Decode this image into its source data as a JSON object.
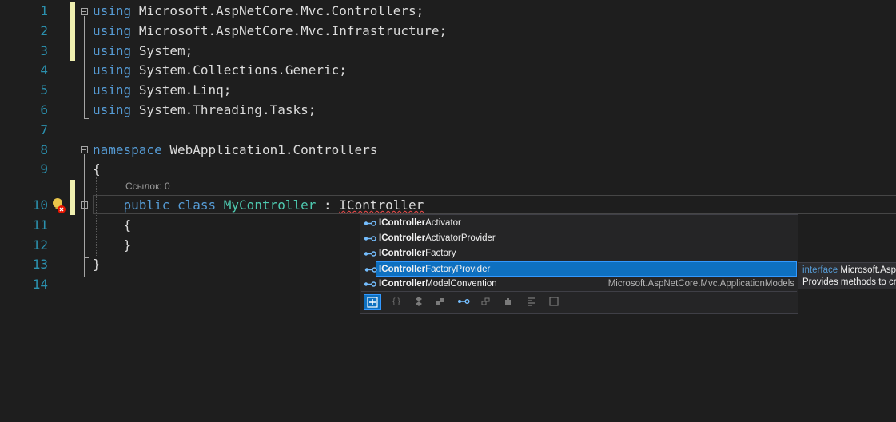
{
  "editor": {
    "lines": [
      {
        "n": "1",
        "tokens": [
          "using",
          "Microsoft.AspNetCore.Mvc.Controllers;"
        ]
      },
      {
        "n": "2",
        "tokens": [
          "using",
          "Microsoft.AspNetCore.Mvc.Infrastructure;"
        ]
      },
      {
        "n": "3",
        "tokens": [
          "using",
          "System;"
        ]
      },
      {
        "n": "4",
        "tokens": [
          "using",
          "System.Collections.Generic;"
        ]
      },
      {
        "n": "5",
        "tokens": [
          "using",
          "System.Linq;"
        ]
      },
      {
        "n": "6",
        "tokens": [
          "using",
          "System.Threading.Tasks;"
        ]
      },
      {
        "n": "7",
        "tokens": []
      },
      {
        "n": "8",
        "tokens": [
          "namespace",
          "WebApplication1.Controllers"
        ]
      },
      {
        "n": "9",
        "tokens": [
          "{"
        ]
      },
      {
        "n": "10",
        "tokens": [
          "public",
          "class",
          "MyController",
          ":",
          "IController"
        ]
      },
      {
        "n": "11",
        "tokens": [
          "{"
        ]
      },
      {
        "n": "12",
        "tokens": [
          "}"
        ]
      },
      {
        "n": "13",
        "tokens": [
          "}"
        ]
      },
      {
        "n": "14",
        "tokens": []
      }
    ],
    "codelens": "Ссылок: 0"
  },
  "completion": {
    "items": [
      {
        "bold": "IController",
        "rest": "Activator",
        "detail": ""
      },
      {
        "bold": "IController",
        "rest": "ActivatorProvider",
        "detail": ""
      },
      {
        "bold": "IController",
        "rest": "Factory",
        "detail": ""
      },
      {
        "bold": "IController",
        "rest": "FactoryProvider",
        "detail": "",
        "selected": true
      },
      {
        "bold": "IController",
        "rest": "ModelConvention",
        "detail": "Microsoft.AspNetCore.Mvc.ApplicationModels"
      }
    ],
    "filter_icons": [
      "expand-filter-icon",
      "namespace-filter-icon",
      "class-filter-icon",
      "structure-filter-icon",
      "interface-filter-icon",
      "enum-filter-icon",
      "delegate-filter-icon",
      "module-filter-icon",
      "keyword-filter-icon",
      "snippet-filter-icon"
    ]
  },
  "tooltip": {
    "keyword": "interface",
    "name": "Microsoft.AspNetCore.Mvc.Infrastructure.IControllerFactoryProvider",
    "description": "Provides methods to create and release a controller."
  },
  "colors": {
    "background": "#1e1e1e",
    "line_number": "#2b91af",
    "keyword": "#569cd6",
    "type": "#4ec9b0",
    "selection": "#0e70c0",
    "change_bar": "#efefb0",
    "error": "#f14c4c"
  }
}
